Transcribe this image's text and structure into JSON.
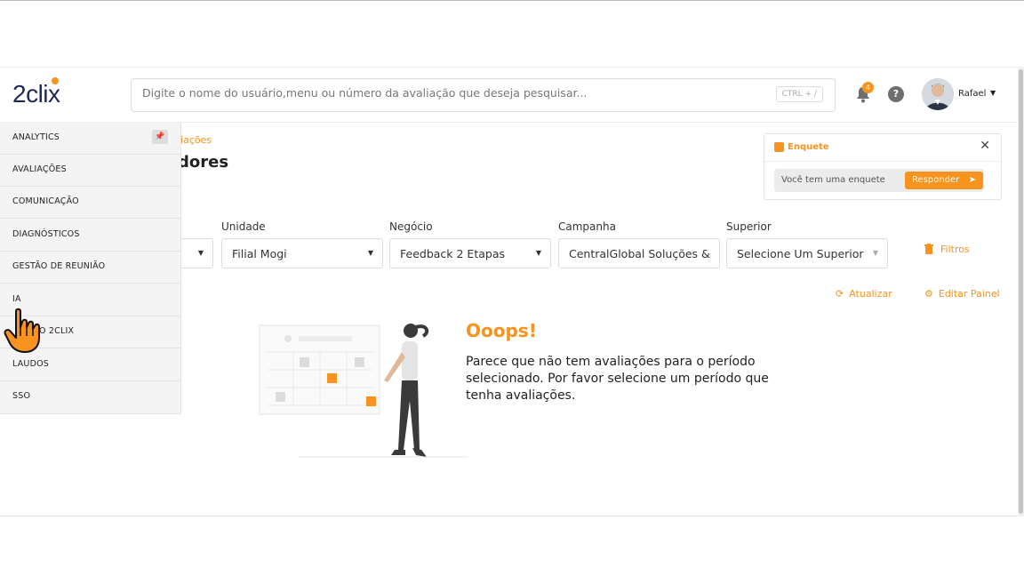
{
  "header": {
    "logo_text": "2clix",
    "search_placeholder": "Digite o nome do usuário,menu ou número da avaliação que deseja pesquisar...",
    "search_shortcut": "CTRL + /",
    "notification_count": "4",
    "help_label": "?",
    "user_name": "Rafael"
  },
  "sidebar": {
    "items": [
      {
        "label": "ANALYTICS"
      },
      {
        "label": "AVALIAÇÕES"
      },
      {
        "label": "COMUNICAÇÃO"
      },
      {
        "label": "DIAGNÓSTICOS"
      },
      {
        "label": "GESTÃO DE REUNIÃO"
      },
      {
        "label": "IA"
      },
      {
        "label": "O 2CLIX"
      },
      {
        "label": "LAUDOS"
      },
      {
        "label": "SSO"
      }
    ]
  },
  "page": {
    "breadcrumb": "liações",
    "title": "dores"
  },
  "filters": {
    "unidade_label": "Unidade",
    "unidade_value": "Filial Mogi",
    "negocio_label": "Negócio",
    "negocio_value": "Feedback 2 Etapas",
    "campanha_label": "Campanha",
    "campanha_value": "CentralGlobal Soluções &",
    "superior_label": "Superior",
    "superior_value": "Selecione Um Superior",
    "filtros_label": "Filtros"
  },
  "actions": {
    "atualizar": "Atualizar",
    "editar_painel": "Editar Painel"
  },
  "enquete": {
    "title": "Enquete",
    "message": "Você tem uma enquete",
    "button": "Responder"
  },
  "empty_state": {
    "title": "Ooops!",
    "message": "Parece que não tem avaliações para o período selecionado. Por favor selecione um período que tenha avaliações."
  },
  "colors": {
    "accent": "#f7931e",
    "brand_dark": "#1e2a55"
  }
}
